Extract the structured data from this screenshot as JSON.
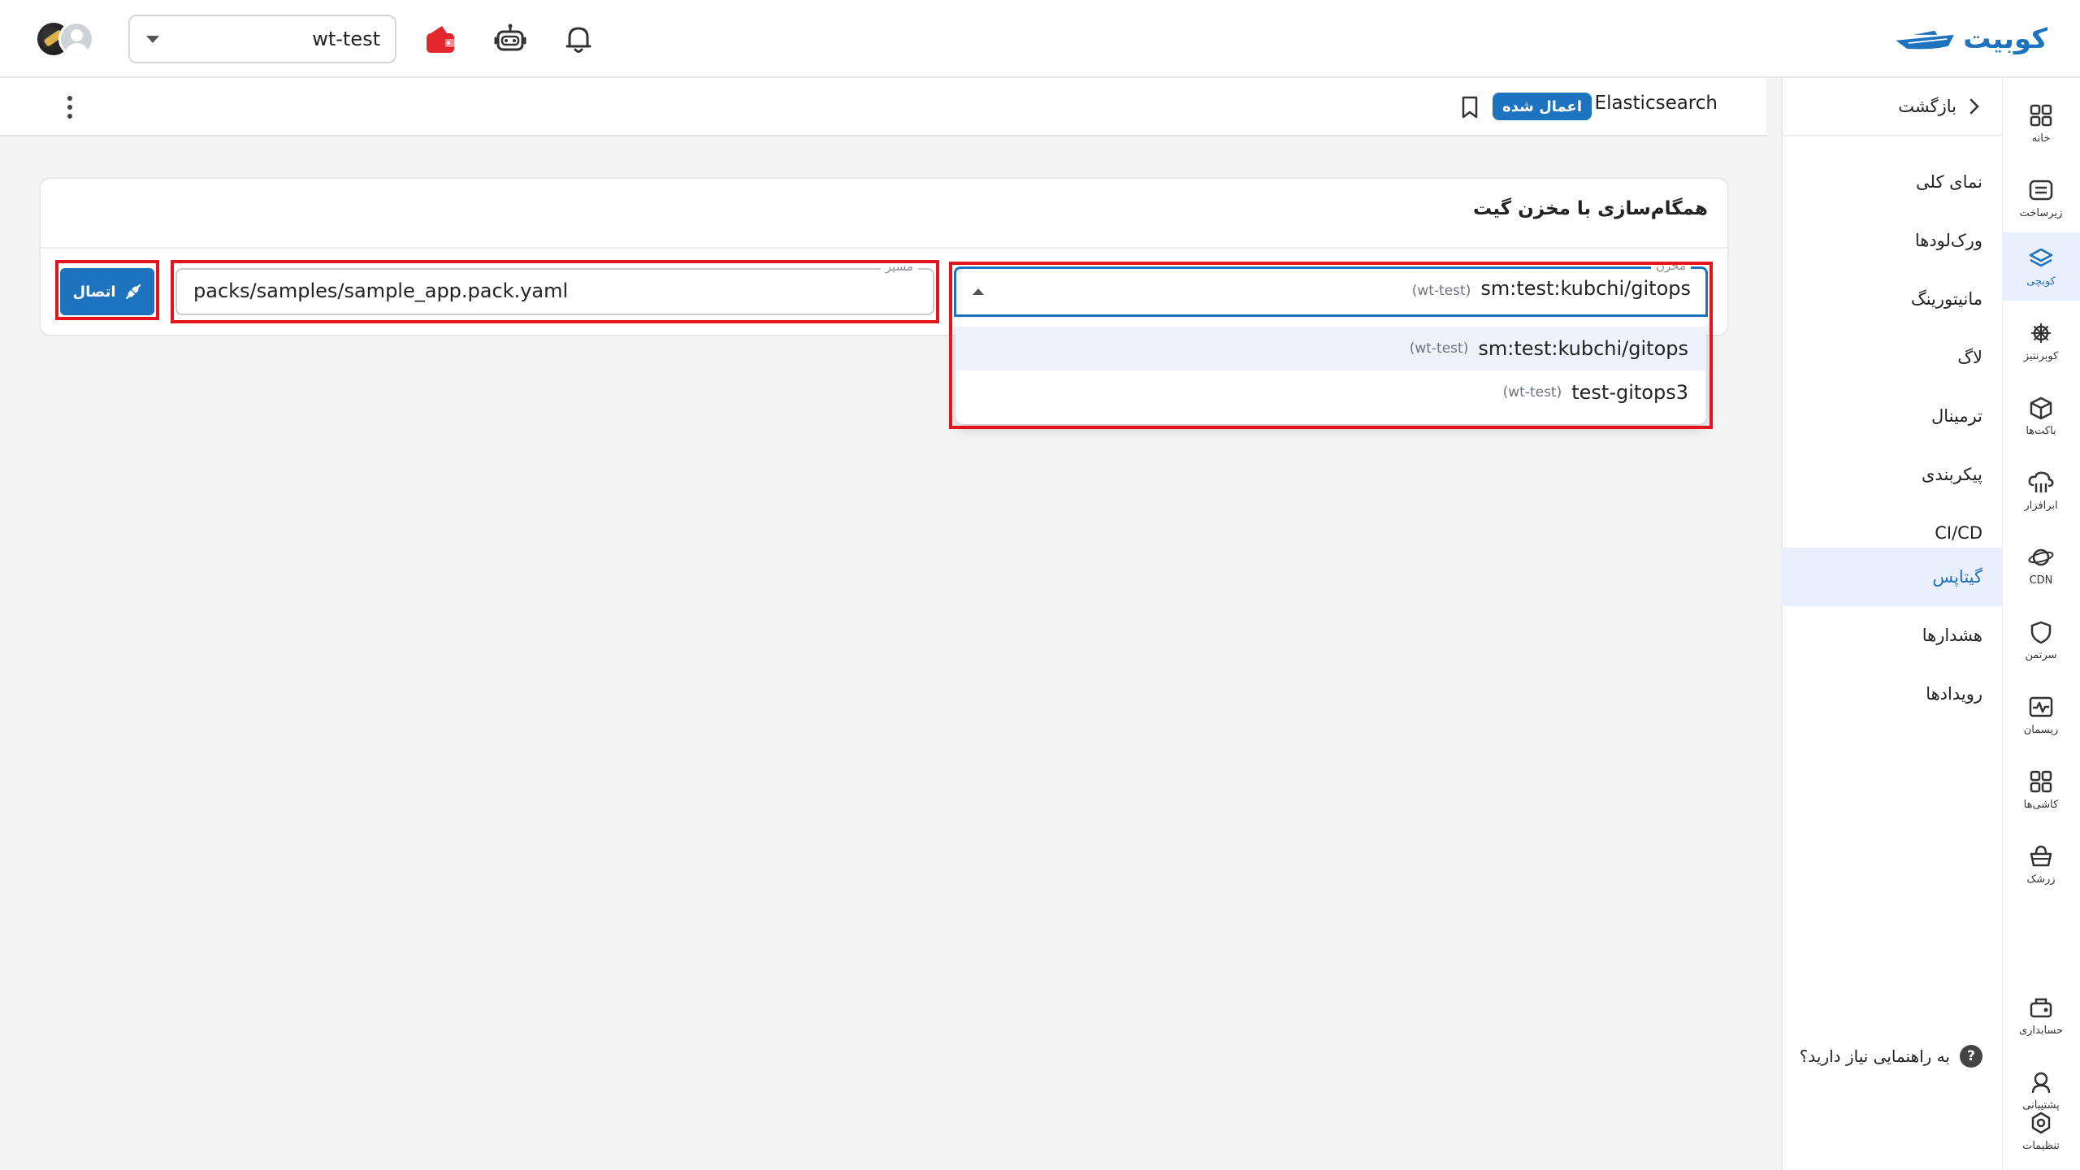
{
  "brand": {
    "name": "کوبیت",
    "color": "#1e73be"
  },
  "topbar": {
    "workspace_value": "wt-test",
    "icons": [
      "wallet-icon",
      "robot-icon",
      "bell-icon"
    ]
  },
  "rail": {
    "items": [
      {
        "label": "خانه",
        "icon": "home-grid-icon"
      },
      {
        "label": "زیرساخت",
        "icon": "server-icon"
      },
      {
        "label": "کوبچی",
        "icon": "layers-icon"
      },
      {
        "label": "کوبرنتیز",
        "icon": "helm-icon"
      },
      {
        "label": "باکت‌ها",
        "icon": "cube-icon"
      },
      {
        "label": "ابرافزار",
        "icon": "cloud-icon"
      },
      {
        "label": "CDN",
        "icon": "orbit-icon"
      },
      {
        "label": "سرتمن",
        "icon": "shield-icon"
      },
      {
        "label": "ریسمان",
        "icon": "pulse-icon"
      },
      {
        "label": "کاشی‌ها",
        "icon": "tiles-icon"
      },
      {
        "label": "زرشک",
        "icon": "basket-icon"
      },
      {
        "label": "حسابداری",
        "icon": "accounting-icon"
      },
      {
        "label": "پشتیبانی",
        "icon": "support-icon"
      },
      {
        "label": "تنظیمات",
        "icon": "settings-icon"
      }
    ]
  },
  "menu": {
    "back_label": "بازگشت",
    "items": [
      {
        "label": "نمای کلی"
      },
      {
        "label": "ورک‌لودها"
      },
      {
        "label": "مانیتورینگ"
      },
      {
        "label": "لاگ"
      },
      {
        "label": "ترمینال"
      },
      {
        "label": "پیکربندی"
      },
      {
        "label": "CI/CD"
      },
      {
        "label": "گیتاپس"
      },
      {
        "label": "هشدارها"
      },
      {
        "label": "رویدادها"
      }
    ],
    "active": "گیتاپس",
    "help_label": "به راهنمایی نیاز دارید؟"
  },
  "subheader": {
    "app_name": "Elasticsearch",
    "status_badge": "اعمال شده"
  },
  "card": {
    "title": "همگام‌سازی با مخزن گیت",
    "repo_field": {
      "label": "مخزن",
      "selected_name": "sm:test:kubchi/gitops",
      "selected_ws": "(wt-test)"
    },
    "path_field": {
      "label": "مسیر",
      "value": "packs/samples/sample_app.pack.yaml"
    },
    "connect_label": "اتصال",
    "dropdown_options": [
      {
        "name": "sm:test:kubchi/gitops",
        "ws": "(wt-test)"
      },
      {
        "name": "test-gitops3",
        "ws": "(wt-test)"
      }
    ]
  }
}
